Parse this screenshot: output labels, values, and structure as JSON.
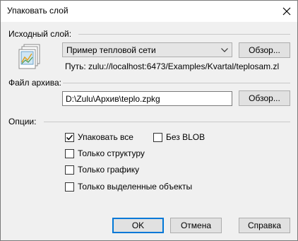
{
  "window": {
    "title": "Упаковать слой"
  },
  "source": {
    "label": "Исходный слой:",
    "layer_value": "Пример тепловой сети",
    "browse_label": "Обзор...",
    "path_text": "Путь: zulu://localhost:6473/Examples/Kvartal/teplosam.zl"
  },
  "archive": {
    "label": "Файл архива:",
    "value": "D:\\Zulu\\Архив\\teplo.zpkg",
    "browse_label": "Обзор..."
  },
  "options": {
    "label": "Опции:",
    "pack_all": {
      "label": "Упаковать все",
      "checked": true
    },
    "no_blob": {
      "label": "Без BLOB",
      "checked": false
    },
    "structure_only": {
      "label": "Только структуру",
      "checked": false
    },
    "graphics_only": {
      "label": "Только графику",
      "checked": false
    },
    "selected_only": {
      "label": "Только выделенные объекты",
      "checked": false
    }
  },
  "footer": {
    "ok_label": "OK",
    "cancel_label": "Отмена",
    "help_label": "Справка"
  }
}
